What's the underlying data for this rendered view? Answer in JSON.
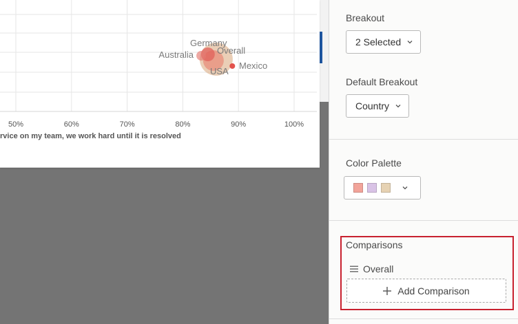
{
  "chart_data": {
    "type": "scatter",
    "x_ticks": [
      "50%",
      "60%",
      "70%",
      "80%",
      "90%",
      "100%"
    ],
    "xlabel_visible": "rvice on my team, we work hard until it is resolved",
    "xlim_percent": [
      45,
      105
    ],
    "points": [
      {
        "label": "Germany",
        "x": 84.5,
        "size": 3,
        "color": "#e0605a"
      },
      {
        "label": "Australia",
        "x": 83.3,
        "size": 2,
        "color": "#e57a72"
      },
      {
        "label": "Overall",
        "x": 86.0,
        "size": 5,
        "color": "#d8a57a"
      },
      {
        "label": "USA",
        "x": 85.5,
        "size": 4,
        "color": "#e86e5e"
      },
      {
        "label": "Mexico",
        "x": 88.9,
        "size": 1,
        "color": "#e0403a"
      }
    ]
  },
  "sidebar": {
    "breakout": {
      "label": "Breakout",
      "value": "2 Selected"
    },
    "default_breakout": {
      "label": "Default Breakout",
      "value": "Country"
    },
    "color_palette": {
      "label": "Color Palette",
      "swatches": [
        "#f2a49a",
        "#d9c3e6",
        "#e6d2b3"
      ]
    },
    "comparisons": {
      "label": "Comparisons",
      "items": [
        "Overall"
      ],
      "add_label": "Add Comparison"
    },
    "highlight_color": "#c8202e"
  }
}
